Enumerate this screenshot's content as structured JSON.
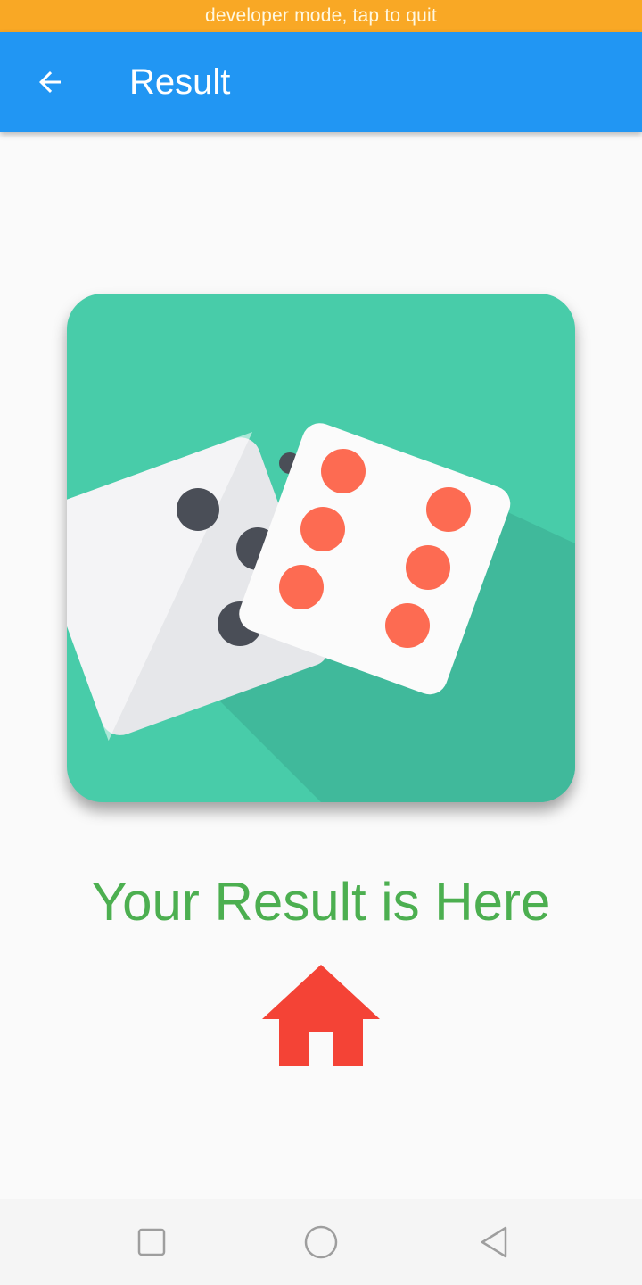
{
  "status_banner": {
    "text": "developer mode, tap to quit"
  },
  "app_bar": {
    "title": "Result",
    "back_icon": "arrow-back-icon",
    "color": "#2196f3"
  },
  "main": {
    "image": {
      "icon": "dice-icon",
      "background_color": "#48cca9"
    },
    "result_text": "Your Result is Here",
    "result_color": "#4caf50",
    "home_icon": "home-icon",
    "home_color": "#f44336"
  },
  "nav_bar": {
    "buttons": [
      "recent-apps-icon",
      "home-circle-icon",
      "back-triangle-icon"
    ]
  }
}
